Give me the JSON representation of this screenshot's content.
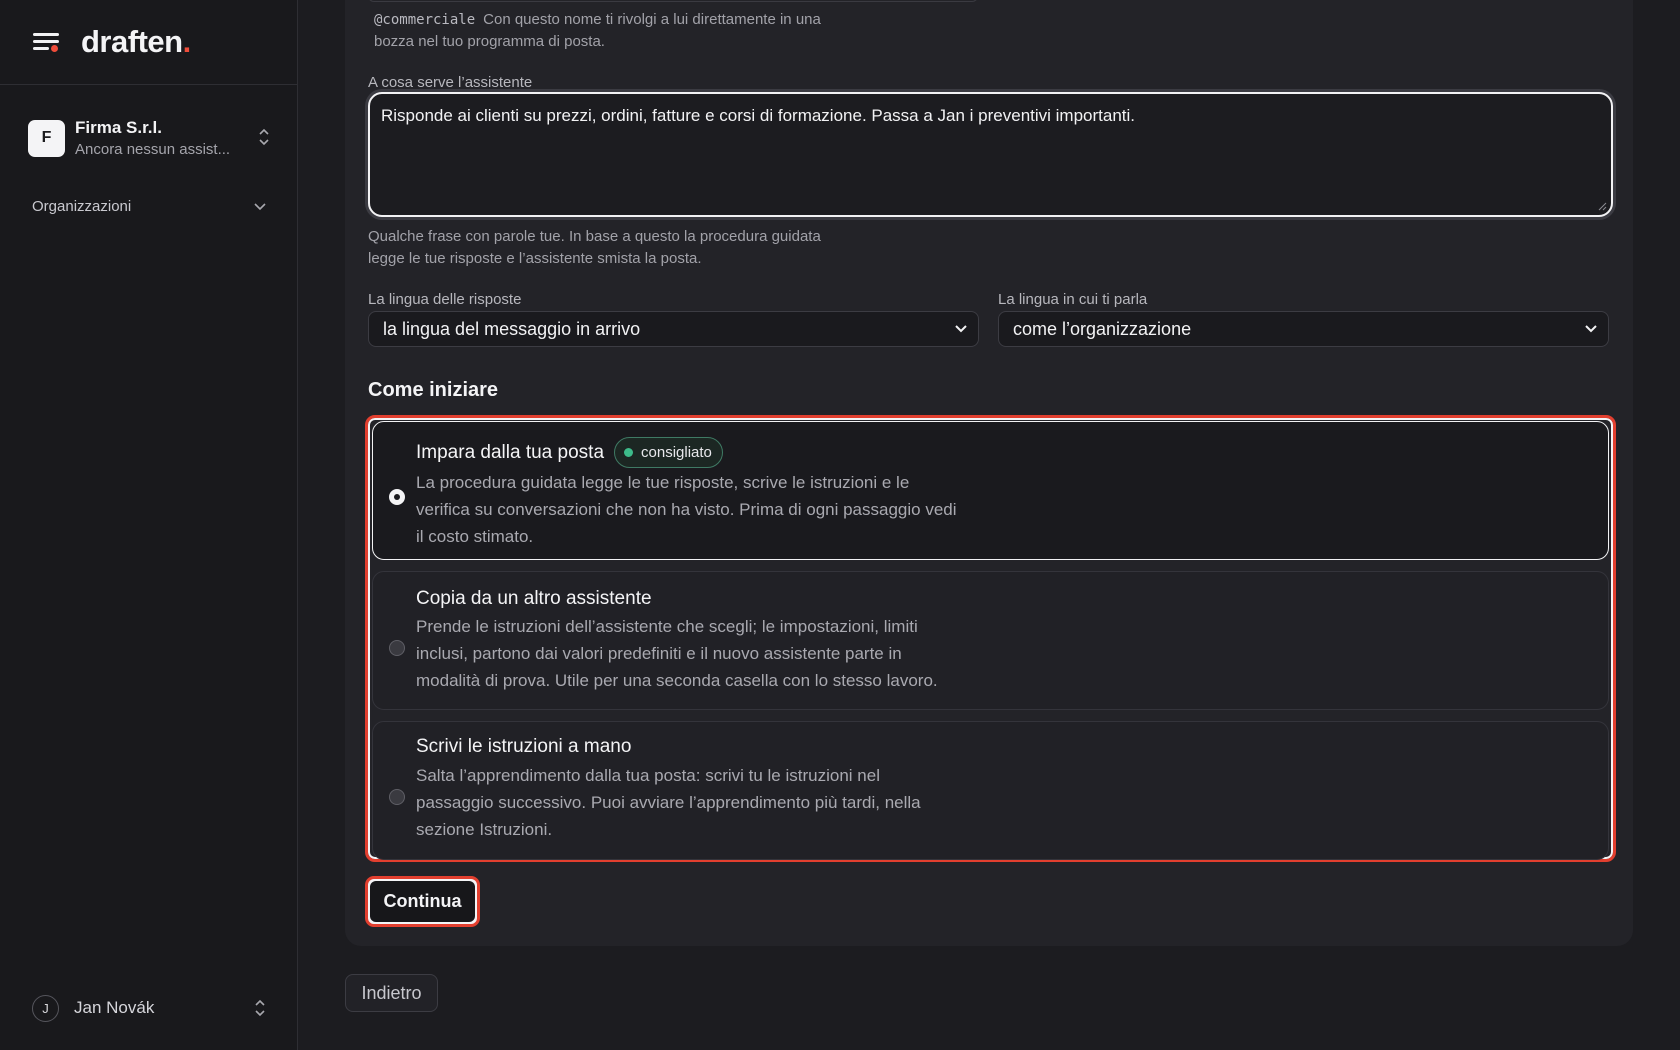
{
  "brand": {
    "name": "draften",
    "period": "."
  },
  "org": {
    "initial": "F",
    "name": "Firma S.r.l.",
    "subtitle": "Ancora nessun assist..."
  },
  "sidebar": {
    "organizations_label": "Organizzazioni"
  },
  "user": {
    "initial": "J",
    "name": "Jan Novák"
  },
  "form": {
    "handle": "@commerciale",
    "handle_hint_line1": "Con questo nome ti rivolgi a lui direttamente in una",
    "handle_hint_line2": "bozza nel tuo programma di posta.",
    "purpose_label": "A cosa serve l’assistente",
    "purpose_value": "Risponde ai clienti su prezzi, ordini, fatture e corsi di formazione. Passa a Jan i preventivi importanti.",
    "purpose_hint_line1": "Qualche frase con parole tue. In base a questo la procedura guidata",
    "purpose_hint_line2": "legge le tue risposte e l’assistente smista la posta.",
    "reply_lang_label": "La lingua delle risposte",
    "reply_lang_value": "la lingua del messaggio in arrivo",
    "talk_lang_label": "La lingua in cui ti parla",
    "talk_lang_value": "come l’organizzazione"
  },
  "start": {
    "title": "Come iniziare",
    "options": [
      {
        "title": "Impara dalla tua posta",
        "badge": "consigliato",
        "desc_line1": "La procedura guidata legge le tue risposte, scrive le istruzioni e le",
        "desc_line2": "verifica su conversazioni che non ha visto. Prima di ogni passaggio vedi",
        "desc_line3": "il costo stimato.",
        "selected": true
      },
      {
        "title": "Copia da un altro assistente",
        "desc_line1": "Prende le istruzioni dell’assistente che scegli; le impostazioni, limiti",
        "desc_line2": "inclusi, partono dai valori predefiniti e il nuovo assistente parte in",
        "desc_line3": "modalità di prova. Utile per una seconda casella con lo stesso lavoro.",
        "selected": false
      },
      {
        "title": "Scrivi le istruzioni a mano",
        "desc_line1": "Salta l’apprendimento dalla tua posta: scrivi tu le istruzioni nel",
        "desc_line2": "passaggio successivo. Puoi avviare l’apprendimento più tardi, nella",
        "desc_line3": "sezione Istruzioni.",
        "selected": false
      }
    ]
  },
  "actions": {
    "continue": "Continua",
    "back": "Indietro"
  }
}
